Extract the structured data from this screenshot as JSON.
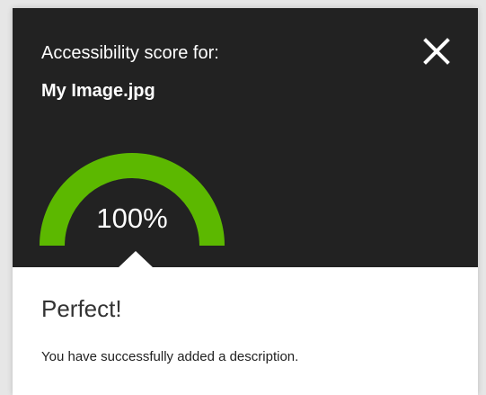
{
  "header": {
    "score_label": "Accessibility score for:",
    "file_name": "My Image.jpg",
    "close_icon": "close-icon"
  },
  "gauge": {
    "value_text": "100%",
    "progress": 1.0,
    "color": "#5cb800"
  },
  "result": {
    "title": "Perfect!",
    "message": "You have successfully added a description."
  },
  "colors": {
    "header_background": "#222222",
    "panel_background": "#ffffff",
    "page_background": "#e6e6e6"
  }
}
